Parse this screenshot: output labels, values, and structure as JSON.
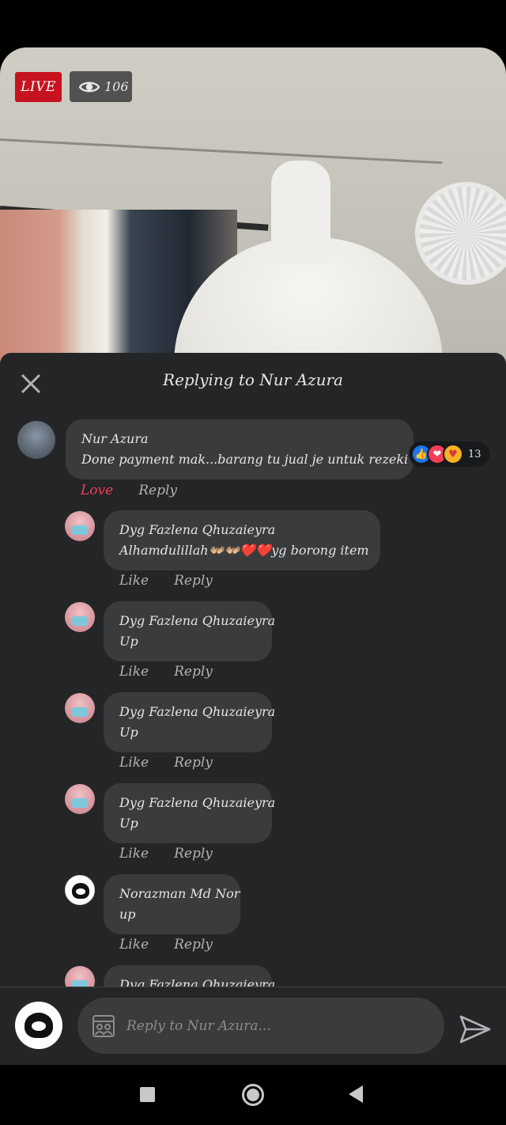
{
  "video": {
    "live_label": "LIVE",
    "viewer_count": "106"
  },
  "panel": {
    "title": "Replying to Nur Azura"
  },
  "main_comment": {
    "author": "Nur Azura",
    "text": "Done payment mak...barang tu jual je untuk rezeki mak",
    "reactions": [
      "like",
      "heart",
      "care"
    ],
    "reaction_count": "13",
    "actions": {
      "love": "Love",
      "reply": "Reply"
    }
  },
  "replies": [
    {
      "author": "Dyg Fazlena Qhuzaieyra",
      "text": "Alhamdulillah👐🏼👐🏼❤️❤️yg borong item",
      "avatar": "pink-avatar"
    },
    {
      "author": "Dyg Fazlena Qhuzaieyra",
      "text": "Up",
      "avatar": "pink-avatar"
    },
    {
      "author": "Dyg Fazlena Qhuzaieyra",
      "text": "Up",
      "avatar": "pink-avatar"
    },
    {
      "author": "Dyg Fazlena Qhuzaieyra",
      "text": "Up",
      "avatar": "pink-avatar"
    },
    {
      "author": "Norazman Md Nor",
      "text": "up",
      "avatar": "panda-avatar"
    },
    {
      "author": "Dyg Fazlena Qhuzaieyra",
      "text": "",
      "avatar": "pink-avatar"
    }
  ],
  "reply_actions": {
    "like": "Like",
    "reply": "Reply"
  },
  "compose": {
    "placeholder": "Reply to Nur Azura..."
  },
  "colors": {
    "panel_bg": "#242526",
    "bubble_bg": "#3a3b3c",
    "live_red": "#c7131f",
    "love_red": "#f33e58",
    "like_blue": "#1877f2"
  }
}
